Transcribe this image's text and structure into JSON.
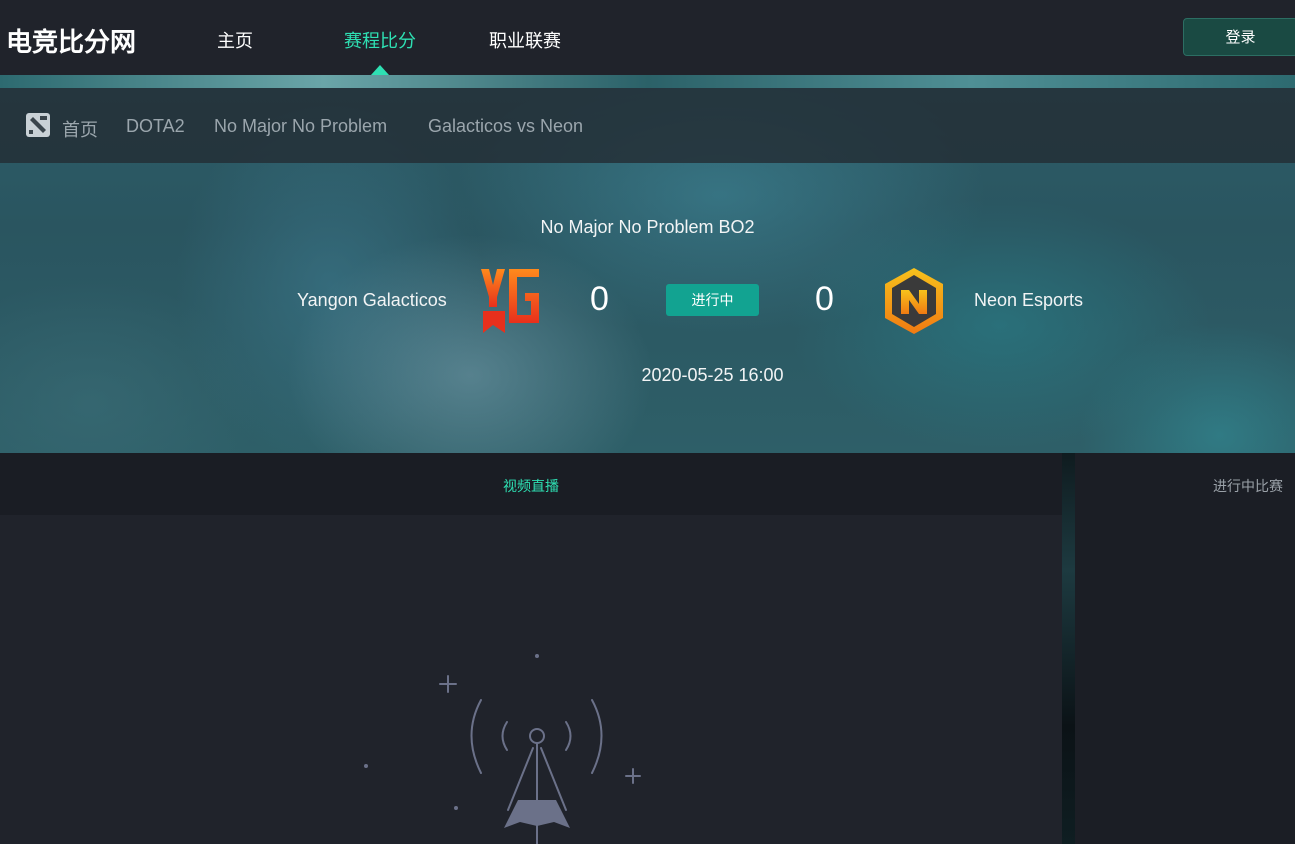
{
  "nav": {
    "logo": "电竞比分网",
    "items": [
      {
        "label": "主页",
        "active": false
      },
      {
        "label": "赛程比分",
        "active": true
      },
      {
        "label": "职业联赛",
        "active": false
      }
    ],
    "login_label": "登录"
  },
  "breadcrumb": {
    "icon": "dota2-icon",
    "items": [
      "首页",
      "DOTA2",
      "No Major No Problem",
      "Galacticos vs Neon"
    ]
  },
  "match": {
    "title": "No Major No Problem BO2",
    "team_left": {
      "name": "Yangon Galacticos",
      "logo": "yg-logo",
      "score": "0"
    },
    "team_right": {
      "name": "Neon Esports",
      "logo": "neon-logo",
      "score": "0"
    },
    "status": "进行中",
    "time": "2020-05-25 16:00"
  },
  "panels": {
    "video_tab": "视频直播",
    "live_matches_title": "进行中比赛"
  },
  "colors": {
    "accent": "#2ee0b3",
    "badge": "#12a391",
    "nav_bg": "#20232b"
  }
}
